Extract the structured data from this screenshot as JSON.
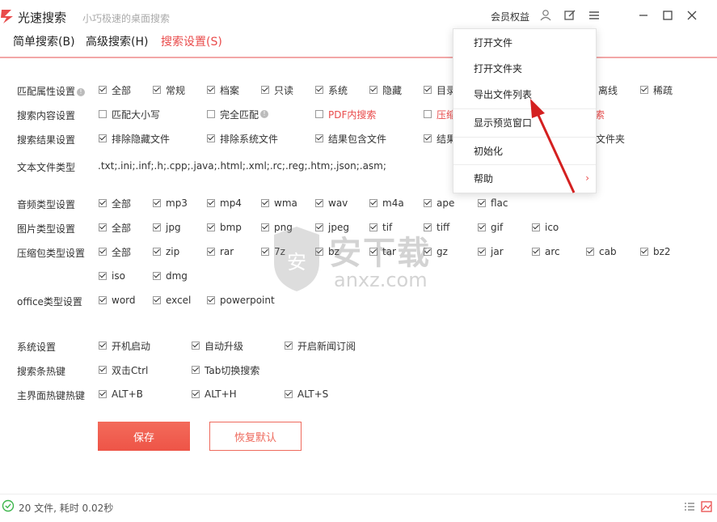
{
  "app": {
    "title": "光速搜索",
    "subtitle": "小巧极速的桌面搜索",
    "member_label": "会员权益"
  },
  "menu": {
    "tabs": [
      "简单搜索(B)",
      "高级搜索(H)",
      "搜索设置(S)"
    ]
  },
  "settings": {
    "match_label": "匹配属性设置",
    "match_options": [
      {
        "label": "全部",
        "checked": true
      },
      {
        "label": "常规",
        "checked": true
      },
      {
        "label": "档案",
        "checked": true
      },
      {
        "label": "只读",
        "checked": true
      },
      {
        "label": "系统",
        "checked": true
      },
      {
        "label": "隐藏",
        "checked": true
      },
      {
        "label": "目录",
        "checked": true
      },
      {
        "label": "离线",
        "checked": true
      },
      {
        "label": "稀疏",
        "checked": true
      }
    ],
    "content_label": "搜索内容设置",
    "content_options": [
      {
        "label": "匹配大小写",
        "checked": false
      },
      {
        "label": "完全匹配",
        "checked": false
      },
      {
        "label": "PDF内搜索",
        "checked": false
      },
      {
        "label": "压缩",
        "checked": false
      },
      {
        "label": "搜索",
        "checked": false
      }
    ],
    "result_label": "搜索结果设置",
    "result_options": [
      {
        "label": "排除隐藏文件",
        "checked": true
      },
      {
        "label": "排除系统文件",
        "checked": true
      },
      {
        "label": "结果包含文件",
        "checked": true
      },
      {
        "label": "结果",
        "checked": true
      },
      {
        "label": "文件夹",
        "checked": true
      }
    ],
    "text_type_label": "文本文件类型",
    "text_type_value": ".txt;.ini;.inf;.h;.cpp;.java;.html;.xml;.rc;.reg;.htm;.json;.asm;",
    "audio_label": "音频类型设置",
    "audio_options": [
      "全部",
      "mp3",
      "mp4",
      "wma",
      "wav",
      "m4a",
      "ape",
      "flac"
    ],
    "image_label": "图片类型设置",
    "image_options": [
      "全部",
      "jpg",
      "bmp",
      "png",
      "jpeg",
      "tif",
      "tiff",
      "gif",
      "ico"
    ],
    "archive_label": "压缩包类型设置",
    "archive_options_row1": [
      "全部",
      "zip",
      "rar",
      "7z",
      "bz",
      "tar",
      "gz",
      "jar",
      "arc",
      "cab",
      "bz2"
    ],
    "archive_options_row2": [
      "iso",
      "dmg"
    ],
    "office_label": "office类型设置",
    "office_options": [
      "word",
      "excel",
      "powerpoint"
    ],
    "system_label": "系统设置",
    "system_options": [
      "开机启动",
      "自动升级",
      "开启新闻订阅"
    ],
    "hotkey_label": "搜索条热键",
    "hotkey_options": [
      "双击Ctrl",
      "Tab切换搜索"
    ],
    "main_hotkey_label": "主界面热键热键",
    "main_hotkey_options": [
      "ALT+B",
      "ALT+H",
      "ALT+S"
    ]
  },
  "buttons": {
    "save": "保存",
    "reset": "恢复默认"
  },
  "status": {
    "text": "20 文件, 耗时 0.02秒"
  },
  "dropdown": {
    "items": [
      "打开文件",
      "打开文件夹",
      "导出文件列表",
      "显示预览窗口",
      "初始化",
      "帮助"
    ]
  },
  "watermark": {
    "cn": "安下载",
    "en": "anxz.com"
  },
  "colors": {
    "accent": "#e94b4b",
    "save_button": "#ee5447",
    "arrow": "#d42020"
  }
}
